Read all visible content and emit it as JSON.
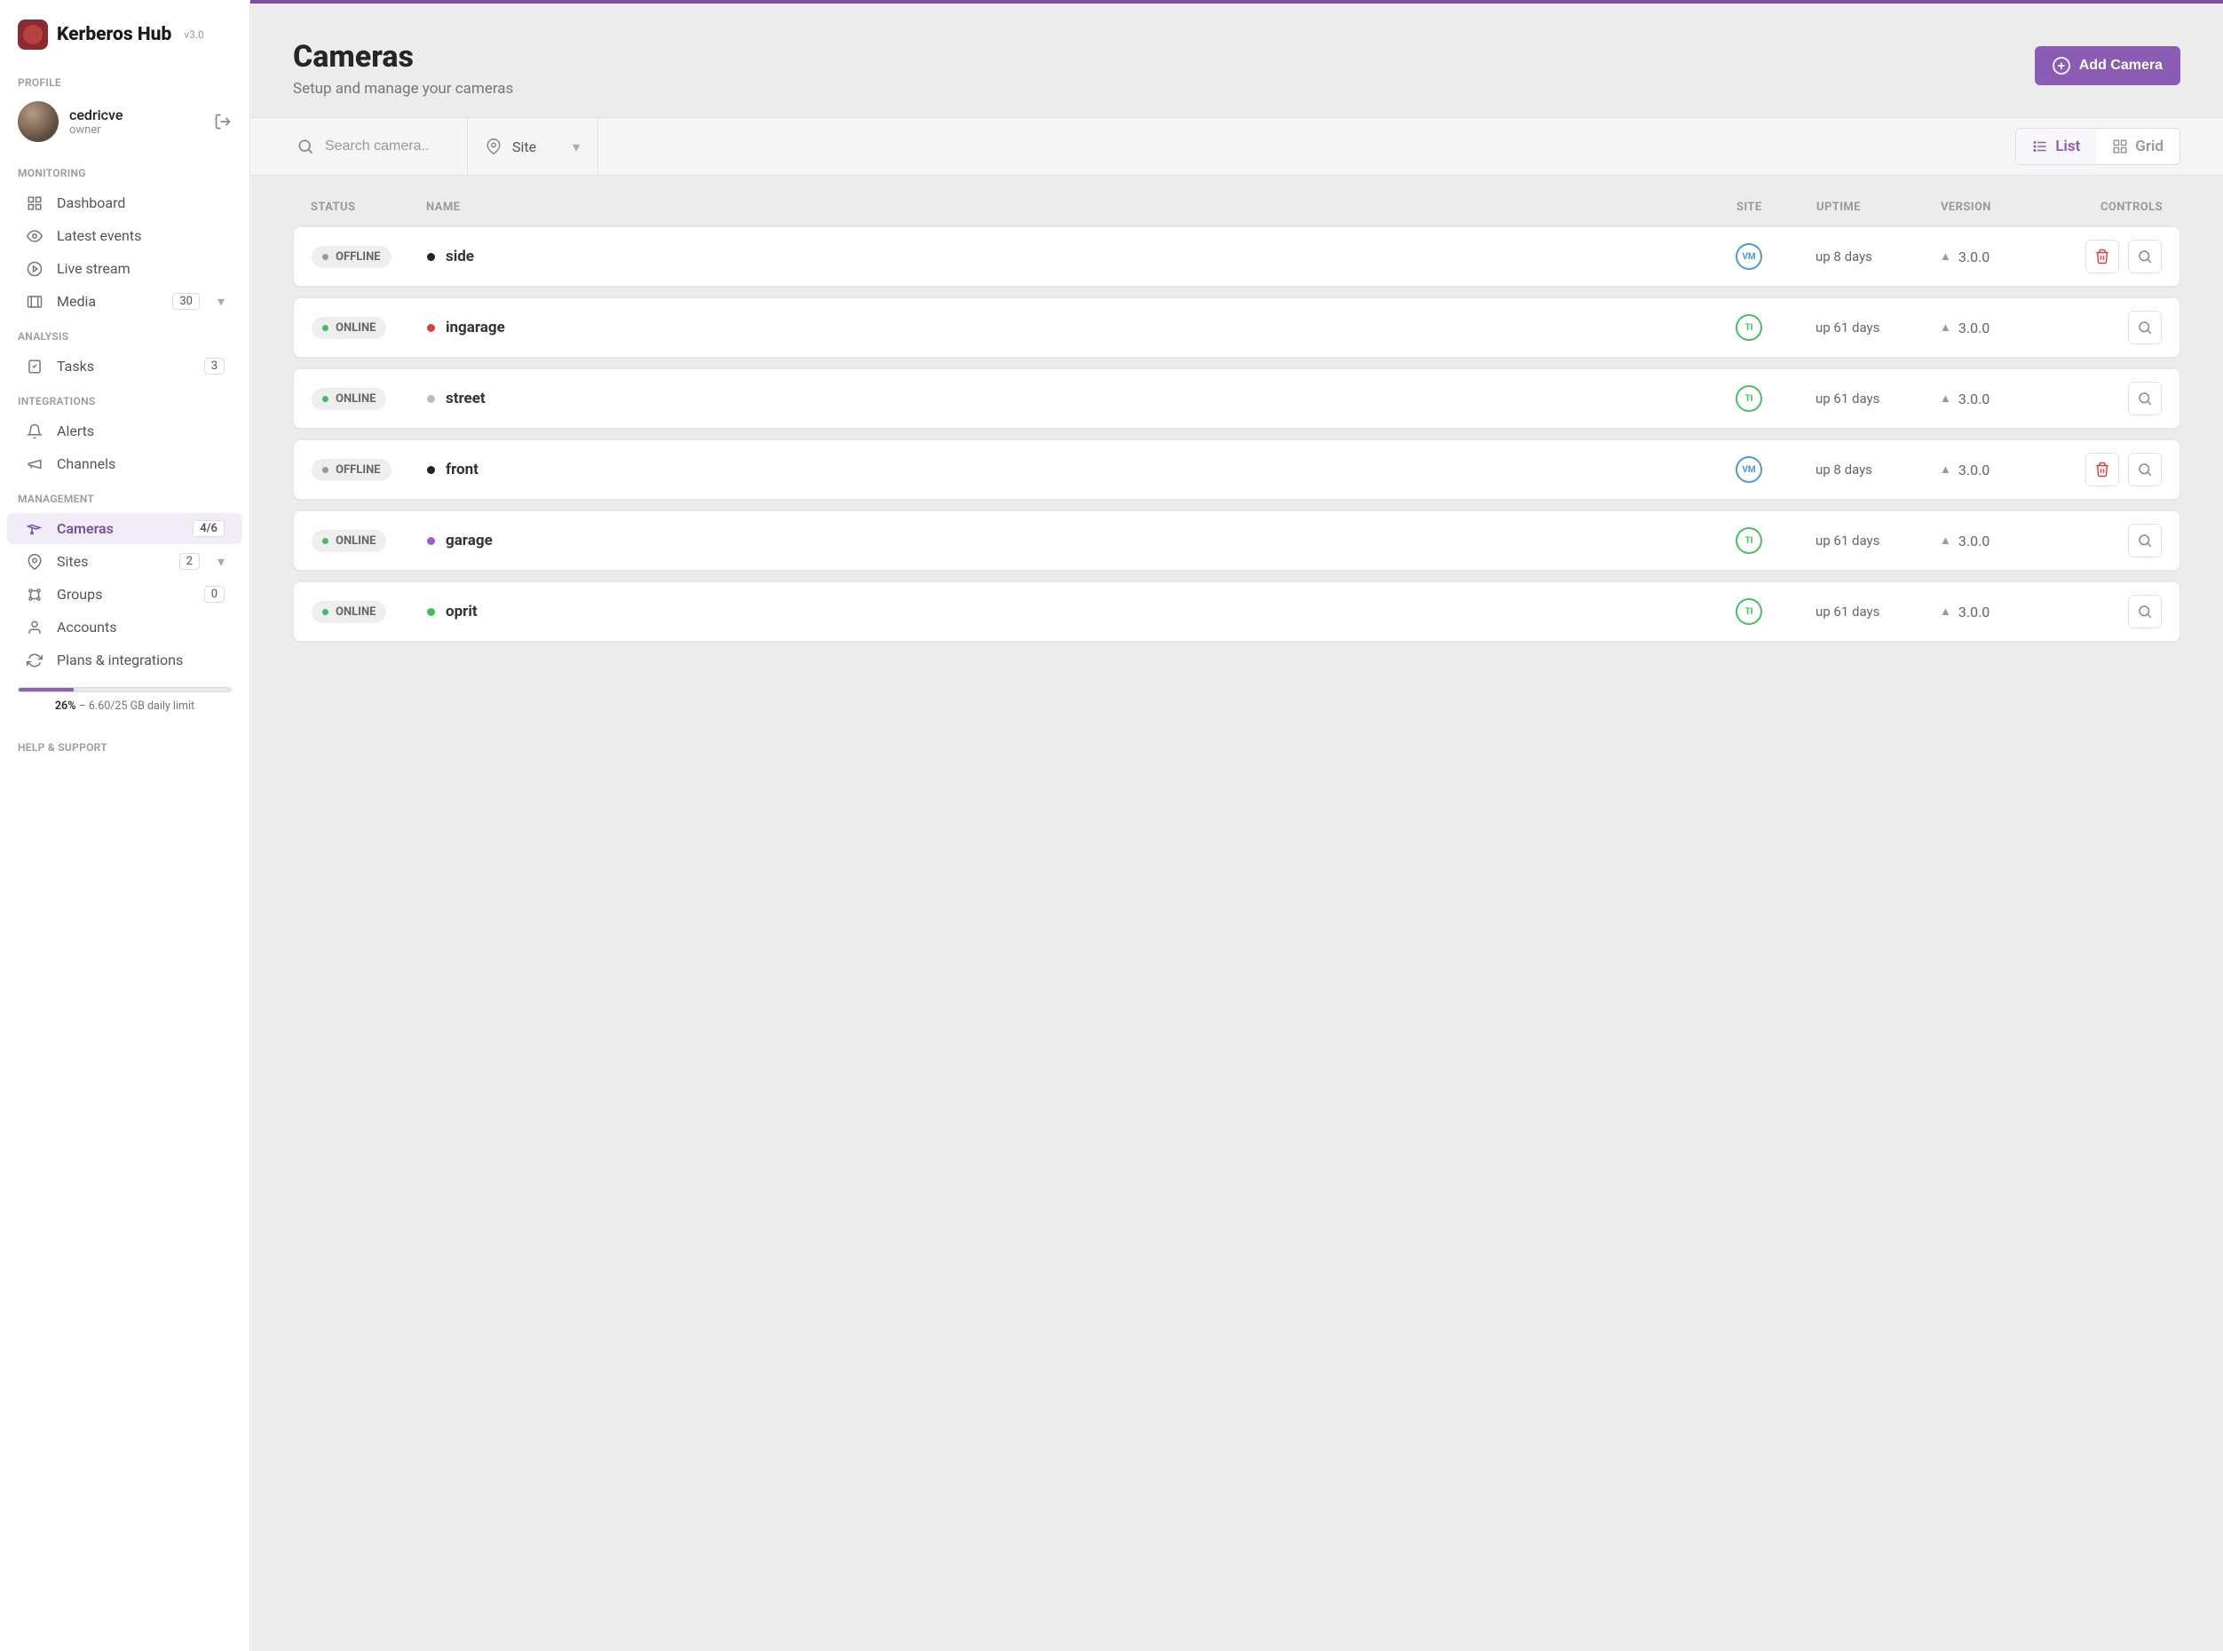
{
  "app": {
    "title": "Kerberos Hub",
    "version": "v3.0"
  },
  "profile": {
    "section": "PROFILE",
    "name": "cedricve",
    "role": "owner"
  },
  "monitoring": {
    "section": "MONITORING",
    "dashboard": "Dashboard",
    "latest_events": "Latest events",
    "live_stream": "Live stream",
    "media": "Media",
    "media_badge": "30"
  },
  "analysis": {
    "section": "ANALYSIS",
    "tasks": "Tasks",
    "tasks_badge": "3"
  },
  "integrations": {
    "section": "INTEGRATIONS",
    "alerts": "Alerts",
    "channels": "Channels"
  },
  "management": {
    "section": "MANAGEMENT",
    "cameras": "Cameras",
    "cameras_badge": "4/6",
    "sites": "Sites",
    "sites_badge": "2",
    "groups": "Groups",
    "groups_badge": "0",
    "accounts": "Accounts",
    "plans": "Plans & integrations"
  },
  "usage": {
    "percent": "26%",
    "rest": " – 6.60/25 GB daily limit"
  },
  "help": {
    "section": "HELP & SUPPORT"
  },
  "header": {
    "title": "Cameras",
    "subtitle": "Setup and manage your cameras",
    "add_button": "Add Camera"
  },
  "filters": {
    "search_placeholder": "Search camera..",
    "site_label": "Site",
    "list": "List",
    "grid": "Grid"
  },
  "table": {
    "headers": {
      "status": "STATUS",
      "name": "NAME",
      "site": "SITE",
      "uptime": "UPTIME",
      "version": "VERSION",
      "controls": "CONTROLS"
    },
    "rows": [
      {
        "status": "OFFLINE",
        "status_online": false,
        "name": "side",
        "name_color": "#222",
        "site_label": "VM",
        "site_class": "chip-vm",
        "uptime": "up 8 days",
        "version": "3.0.0",
        "trash": true
      },
      {
        "status": "ONLINE",
        "status_online": true,
        "name": "ingarage",
        "name_color": "#d9423b",
        "site_label": "TI",
        "site_class": "chip-ti",
        "uptime": "up 61 days",
        "version": "3.0.0",
        "trash": false
      },
      {
        "status": "ONLINE",
        "status_online": true,
        "name": "street",
        "name_color": "#bdbdbd",
        "site_label": "TI",
        "site_class": "chip-ti",
        "uptime": "up 61 days",
        "version": "3.0.0",
        "trash": false
      },
      {
        "status": "OFFLINE",
        "status_online": false,
        "name": "front",
        "name_color": "#222",
        "site_label": "VM",
        "site_class": "chip-vm",
        "uptime": "up 8 days",
        "version": "3.0.0",
        "trash": true
      },
      {
        "status": "ONLINE",
        "status_online": true,
        "name": "garage",
        "name_color": "#a15bd8",
        "site_label": "TI",
        "site_class": "chip-ti",
        "uptime": "up 61 days",
        "version": "3.0.0",
        "trash": false
      },
      {
        "status": "ONLINE",
        "status_online": true,
        "name": "oprit",
        "name_color": "#3fbf5a",
        "site_label": "TI",
        "site_class": "chip-ti",
        "uptime": "up 61 days",
        "version": "3.0.0",
        "trash": false
      }
    ]
  }
}
